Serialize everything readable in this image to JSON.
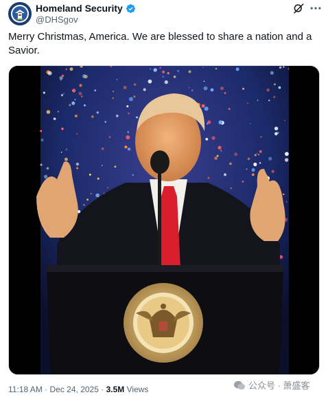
{
  "account": {
    "display_name": "Homeland Security",
    "handle": "@DHSgov",
    "verified": true,
    "avatar_icon": "dhs-seal-icon"
  },
  "post": {
    "text": "Merry Christmas, America. We are blessed to share a nation and a Savior.",
    "media_type": "video",
    "media_description_icon": "video-frame-speaker-at-podium"
  },
  "meta": {
    "time": "11:18 AM",
    "separator": "·",
    "date": "Dec 24, 2025",
    "views_count": "3.5M",
    "views_label": "Views"
  },
  "actions": {
    "grok_icon": "grok-icon",
    "more_icon": "more-icon"
  },
  "watermark": {
    "text": "公众号 · 萧盛客"
  },
  "colors": {
    "verified_blue": "#1d9bf0",
    "text_primary": "#0f1419",
    "text_secondary": "#536471"
  }
}
